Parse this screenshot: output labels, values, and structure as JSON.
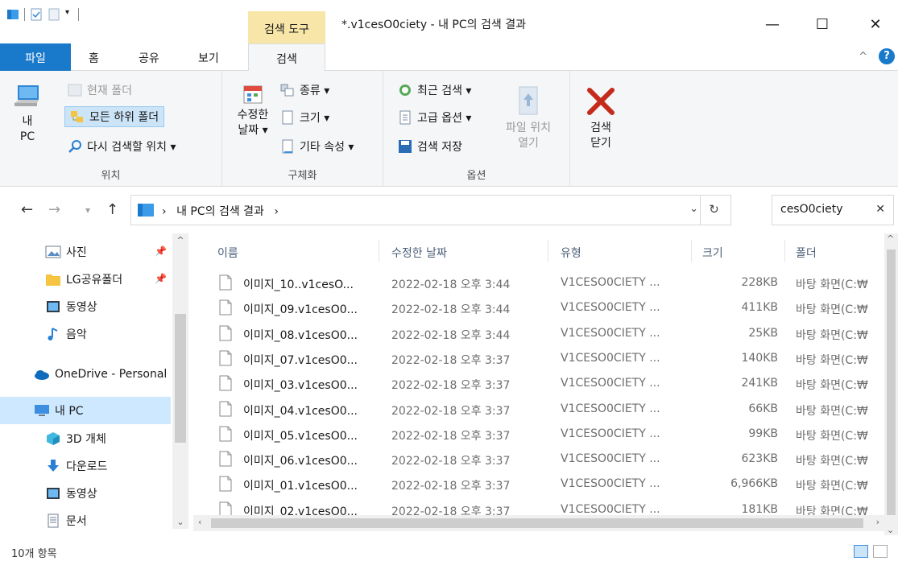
{
  "window": {
    "title": "*.v1cesO0ciety - 내 PC의 검색 결과",
    "context_tab_group": "검색 도구",
    "minimize": "—",
    "maximize": "☐",
    "close": "✕"
  },
  "tabs": {
    "file": "파일",
    "home": "홈",
    "share": "공유",
    "view": "보기",
    "search": "검색",
    "collapse": "^",
    "help": "?"
  },
  "ribbon": {
    "location": {
      "label": "위치",
      "this_pc": "내\nPC",
      "current_folder": "현재 폴더",
      "all_subfolders": "모든 하위 폴더",
      "search_again_in": "다시 검색할 위치 ▾"
    },
    "refine": {
      "label": "구체화",
      "date_modified": "수정한\n날짜 ▾",
      "kind": "종류 ▾",
      "size": "크기 ▾",
      "other_properties": "기타 속성 ▾"
    },
    "options": {
      "label": "옵션",
      "recent_searches": "최근 검색 ▾",
      "advanced_options": "고급 옵션 ▾",
      "save_search": "검색 저장",
      "open_file_location": "파일 위치\n열기"
    },
    "close_search": "검색\n닫기"
  },
  "addressbar": {
    "breadcrumb": "내 PC의 검색 결과",
    "chevron": "›",
    "search_query": "cesO0ciety"
  },
  "nav": {
    "items": [
      {
        "label": "사진",
        "icon": "pictures-icon",
        "pinned": true
      },
      {
        "label": "LG공유폴더",
        "icon": "folder-icon",
        "pinned": true
      },
      {
        "label": "동영상",
        "icon": "videos-icon",
        "pinned": false
      },
      {
        "label": "음악",
        "icon": "music-icon",
        "pinned": false
      },
      {
        "label": "OneDrive - Personal",
        "icon": "onedrive-icon",
        "pinned": false
      },
      {
        "label": "내 PC",
        "icon": "this-pc-icon",
        "pinned": false,
        "selected": true
      },
      {
        "label": "3D 개체",
        "icon": "3d-objects-icon",
        "pinned": false
      },
      {
        "label": "다운로드",
        "icon": "downloads-icon",
        "pinned": false
      },
      {
        "label": "동영상",
        "icon": "videos-icon",
        "pinned": false
      },
      {
        "label": "문서",
        "icon": "documents-icon",
        "pinned": false
      }
    ]
  },
  "list": {
    "columns": [
      "이름",
      "수정한 날짜",
      "유형",
      "크기",
      "폴더"
    ],
    "rows": [
      {
        "name": "이미지_10..v1cesO...",
        "date": "2022-02-18 오후 3:44",
        "type": "V1CESO0CIETY ...",
        "size": "228KB",
        "folder": "바탕 화면(C:₩"
      },
      {
        "name": "이미지_09.v1cesO0...",
        "date": "2022-02-18 오후 3:44",
        "type": "V1CESO0CIETY ...",
        "size": "411KB",
        "folder": "바탕 화면(C:₩"
      },
      {
        "name": "이미지_08.v1cesO0...",
        "date": "2022-02-18 오후 3:44",
        "type": "V1CESO0CIETY ...",
        "size": "25KB",
        "folder": "바탕 화면(C:₩"
      },
      {
        "name": "이미지_07.v1cesO0...",
        "date": "2022-02-18 오후 3:37",
        "type": "V1CESO0CIETY ...",
        "size": "140KB",
        "folder": "바탕 화면(C:₩"
      },
      {
        "name": "이미지_03.v1cesO0...",
        "date": "2022-02-18 오후 3:37",
        "type": "V1CESO0CIETY ...",
        "size": "241KB",
        "folder": "바탕 화면(C:₩"
      },
      {
        "name": "이미지_04.v1cesO0...",
        "date": "2022-02-18 오후 3:37",
        "type": "V1CESO0CIETY ...",
        "size": "66KB",
        "folder": "바탕 화면(C:₩"
      },
      {
        "name": "이미지_05.v1cesO0...",
        "date": "2022-02-18 오후 3:37",
        "type": "V1CESO0CIETY ...",
        "size": "99KB",
        "folder": "바탕 화면(C:₩"
      },
      {
        "name": "이미지_06.v1cesO0...",
        "date": "2022-02-18 오후 3:37",
        "type": "V1CESO0CIETY ...",
        "size": "623KB",
        "folder": "바탕 화면(C:₩"
      },
      {
        "name": "이미지_01.v1cesO0...",
        "date": "2022-02-18 오후 3:37",
        "type": "V1CESO0CIETY ...",
        "size": "6,966KB",
        "folder": "바탕 화면(C:₩"
      },
      {
        "name": "이미지_02.v1cesO0...",
        "date": "2022-02-18 오후 3:37",
        "type": "V1CESO0CIETY ...",
        "size": "181KB",
        "folder": "바탕 화면(C:₩"
      }
    ]
  },
  "status": {
    "item_count": "10개 항목"
  },
  "colors": {
    "file_tab": "#1979ca",
    "context_tab": "#f7e6a8",
    "selected": "#cde8ff",
    "close_x": "#c42b1c"
  }
}
